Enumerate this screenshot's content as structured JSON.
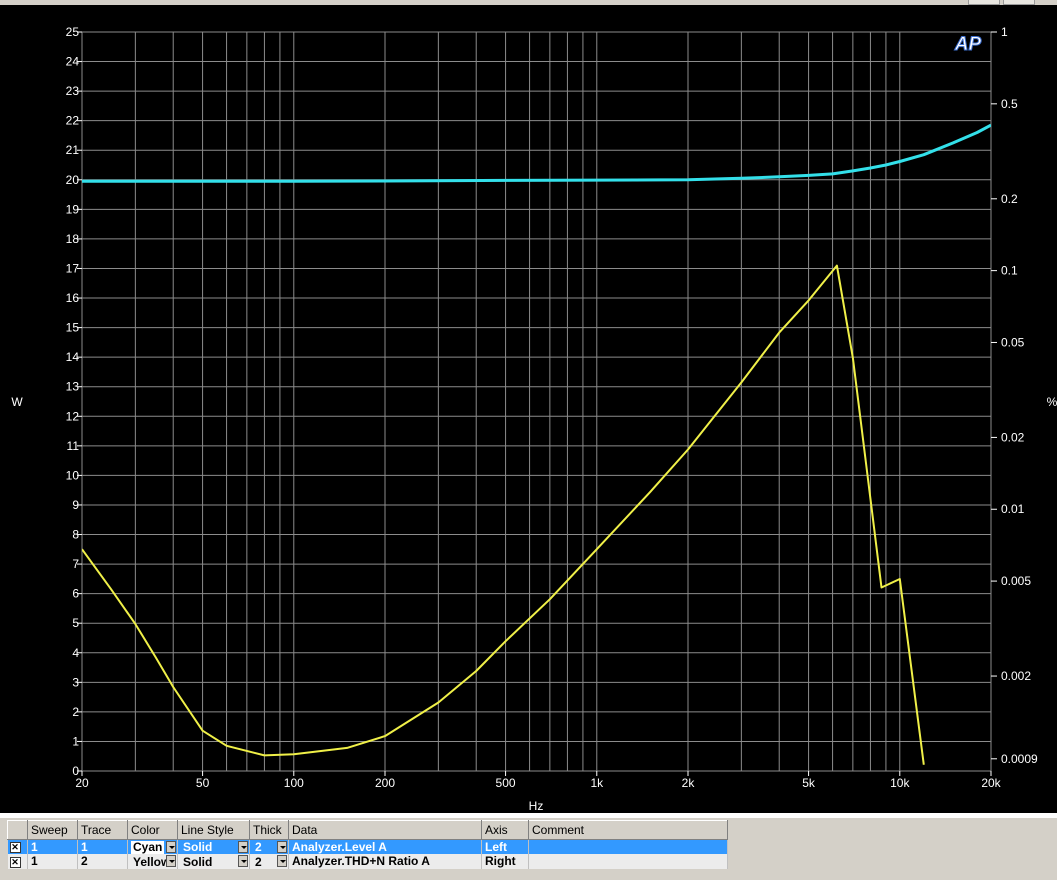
{
  "chart_data": {
    "type": "line",
    "xlabel": "Hz",
    "ylabel": "W",
    "y2label": "%",
    "xscale": "log",
    "xlim": [
      20,
      20000
    ],
    "ylim": [
      0,
      25
    ],
    "y2scale": "log",
    "y2lim": [
      0.0008,
      1
    ],
    "grid": true,
    "xticks": [
      20,
      50,
      100,
      200,
      500,
      1000,
      2000,
      5000,
      10000,
      20000
    ],
    "xtick_labels": [
      "20",
      "50",
      "100",
      "200",
      "500",
      "1k",
      "2k",
      "5k",
      "10k",
      "20k"
    ],
    "yticks": [
      0,
      1,
      2,
      3,
      4,
      5,
      6,
      7,
      8,
      9,
      10,
      11,
      12,
      13,
      14,
      15,
      16,
      17,
      18,
      19,
      20,
      21,
      22,
      23,
      24,
      25
    ],
    "y2ticks": [
      1,
      0.5,
      0.2,
      0.1,
      0.05,
      0.02,
      0.01,
      0.005,
      0.002,
      0.0009
    ],
    "y2tick_labels": [
      "1",
      "0.5",
      "0.2",
      "0.1",
      "0.05",
      "0.02",
      "0.01",
      "0.005",
      "0.002",
      "0.0009"
    ],
    "series": [
      {
        "axis": "left",
        "color": "#33e0ea",
        "x": [
          20,
          50,
          100,
          200,
          500,
          1000,
          2000,
          3000,
          4000,
          5000,
          6000,
          7000,
          8000,
          9000,
          10000,
          12000,
          15000,
          18000,
          20000
        ],
        "y": [
          19.95,
          19.95,
          19.95,
          19.96,
          19.98,
          19.99,
          20.0,
          20.05,
          20.1,
          20.15,
          20.2,
          20.3,
          20.4,
          20.5,
          20.62,
          20.85,
          21.25,
          21.6,
          21.85
        ]
      },
      {
        "axis": "right",
        "color": "#f0f048",
        "x": [
          20,
          25,
          30,
          35,
          40,
          50,
          60,
          80,
          100,
          150,
          200,
          300,
          400,
          500,
          700,
          1000,
          1500,
          2000,
          3000,
          4000,
          5000,
          6200,
          7000,
          8700,
          10000,
          12000
        ],
        "y": [
          0.0068,
          0.0046,
          0.0033,
          0.0024,
          0.0018,
          0.00118,
          0.00102,
          0.00093,
          0.00094,
          0.001,
          0.00112,
          0.00155,
          0.0021,
          0.0028,
          0.0042,
          0.0068,
          0.0118,
          0.0178,
          0.034,
          0.055,
          0.075,
          0.105,
          0.043,
          0.0047,
          0.0051,
          0.00085
        ]
      }
    ]
  },
  "table": {
    "headers": [
      "Sweep",
      "Trace",
      "Color",
      "Line Style",
      "Thick",
      "Data",
      "Axis",
      "Comment"
    ],
    "rows": [
      {
        "checked": "✕",
        "sweep": "1",
        "trace": "1",
        "color": "Cyan",
        "style": "Solid",
        "thick": "2",
        "data": "Analyzer.Level A",
        "axis": "Left",
        "comment": ""
      },
      {
        "checked": "✕",
        "sweep": "1",
        "trace": "2",
        "color": "Yellow",
        "style": "Solid",
        "thick": "2",
        "data": "Analyzer.THD+N Ratio A",
        "axis": "Right",
        "comment": ""
      }
    ]
  },
  "logo": {
    "text": "AP"
  },
  "colors": {
    "grid": "#8c8c8c",
    "axis_text": "#ffffff",
    "background": "#000000",
    "selected_row": "#3399ff"
  }
}
